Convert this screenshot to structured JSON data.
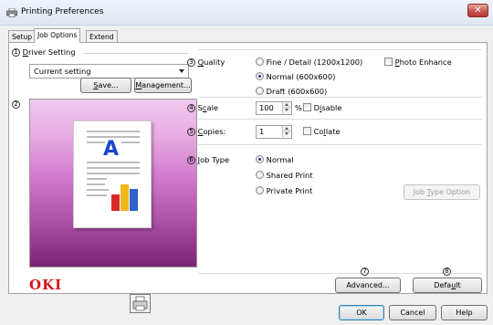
{
  "window": {
    "title": "Printing Preferences",
    "close_glyph": "✕"
  },
  "tabs": [
    {
      "label": "Setup"
    },
    {
      "label": "Job Options"
    },
    {
      "label": "Extend"
    }
  ],
  "markers": [
    "1",
    "2",
    "3",
    "4",
    "5",
    "6",
    "7",
    "8"
  ],
  "driver_setting": {
    "label_underlined": "D",
    "label_rest": "river Setting",
    "combo_value": "Current setting",
    "save_underlined": "S",
    "save_rest": "ave...",
    "management_underlined": "M",
    "management_rest": "anagement..."
  },
  "preview": {
    "letter": "A",
    "colors": {
      "letter": "#1a46c8",
      "bar_red": "#d9282a",
      "bar_yellow": "#f2b71b",
      "bar_blue": "#2c62c9"
    }
  },
  "brand": {
    "logo": "OKI",
    "color": "#d7141b"
  },
  "quality": {
    "label_underlined": "Q",
    "label_rest": "uality",
    "options": [
      "Fine / Detail (1200x1200)",
      "Normal (600x600)",
      "Draft (600x600)"
    ],
    "selected": "Normal (600x600)",
    "photo_enhance_underlined": "P",
    "photo_enhance_rest": "hoto Enhance",
    "photo_enhance_checked": false
  },
  "scale": {
    "label_pre": "S",
    "label_underlined": "c",
    "label_rest": "ale",
    "value": "100",
    "unit": "%",
    "disable_pre": "D",
    "disable_underlined": "i",
    "disable_rest": "sable",
    "disable_checked": false
  },
  "copies": {
    "label_underlined": "C",
    "label_rest": "opies:",
    "value": "1",
    "collate_pre": "Co",
    "collate_underlined": "l",
    "collate_rest": "late",
    "collate_checked": false
  },
  "job_type": {
    "label_underlined": "J",
    "label_rest": "ob Type",
    "options": [
      "Normal",
      "Shared Print",
      "Private Print"
    ],
    "selected": "Normal",
    "option_button_pre": "Job ",
    "option_button_underlined": "T",
    "option_button_rest": "ype Option"
  },
  "bottom": {
    "advanced_label": "Advanced...",
    "default_pre": "Defa",
    "default_underlined": "u",
    "default_rest": "lt"
  },
  "footer": {
    "ok": "OK",
    "cancel": "Cancel",
    "help": "Help"
  }
}
